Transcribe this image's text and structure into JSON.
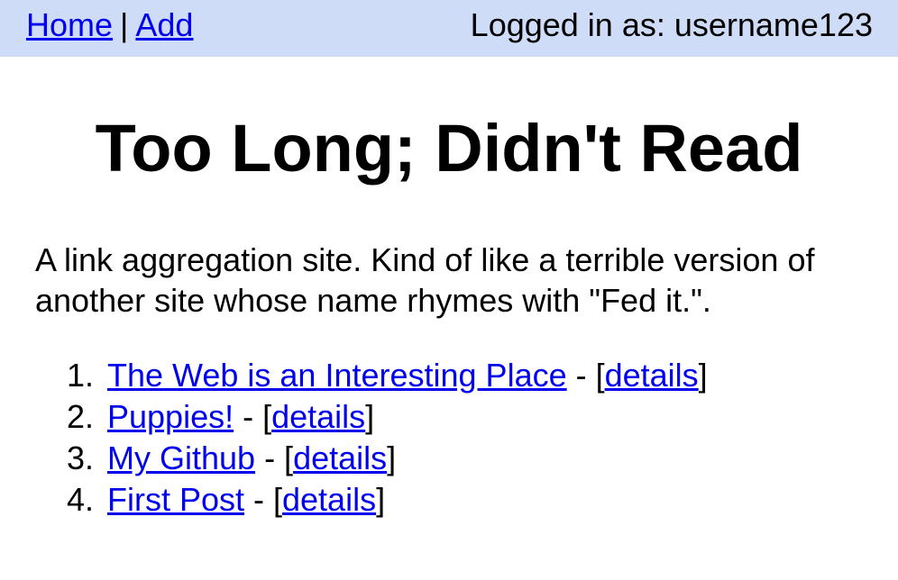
{
  "topbar": {
    "home_label": "Home",
    "separator": "|",
    "add_label": "Add",
    "login_text": "Logged in as: username123",
    "background_color": "#cfdcf8"
  },
  "main": {
    "title": "Too Long; Didn't Read",
    "description": "A link aggregation site. Kind of like a terrible version of another site whose name rhymes with \"Fed it.\".",
    "links": [
      {
        "number": "1.",
        "title": "The Web is an Interesting Place",
        "dash": " - [",
        "details": "details",
        "close": "]"
      },
      {
        "number": "2.",
        "title": "Puppies!",
        "dash": " - [",
        "details": "details",
        "close": "]"
      },
      {
        "number": "3.",
        "title": "My Github",
        "dash": " - [",
        "details": "details",
        "close": "]"
      },
      {
        "number": "4.",
        "title": "First Post",
        "dash": " - [",
        "details": "details",
        "close": "]"
      }
    ]
  },
  "colors": {
    "link": "#0000ee",
    "text": "#000000",
    "background": "#ffffff"
  }
}
